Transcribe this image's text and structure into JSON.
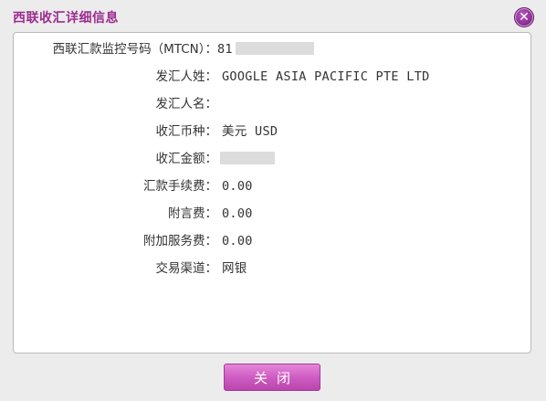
{
  "dialog": {
    "title": "西联收汇详细信息",
    "close_icon": "close-icon",
    "close_glyph": "✕",
    "close_button_label": "关闭"
  },
  "details": [
    {
      "label": "西联汇款监控号码（MTCN）：",
      "value": "81",
      "masked": true
    },
    {
      "label": "发汇人姓：",
      "value": "GOOGLE ASIA PACIFIC PTE LTD",
      "masked": false
    },
    {
      "label": "发汇人名：",
      "value": "",
      "masked": false
    },
    {
      "label": "收汇币种：",
      "value": "美元 USD",
      "masked": false
    },
    {
      "label": "收汇金额：",
      "value": "",
      "masked": true
    },
    {
      "label": "汇款手续费：",
      "value": "0.00",
      "masked": false
    },
    {
      "label": "附言费：",
      "value": "0.00",
      "masked": false
    },
    {
      "label": "附加服务费：",
      "value": "0.00",
      "masked": false
    },
    {
      "label": "交易渠道：",
      "value": "网银",
      "masked": false
    }
  ],
  "colors": {
    "title": "#9b2c8f",
    "button": "#cf5cc2",
    "close": "#8a2f93"
  }
}
